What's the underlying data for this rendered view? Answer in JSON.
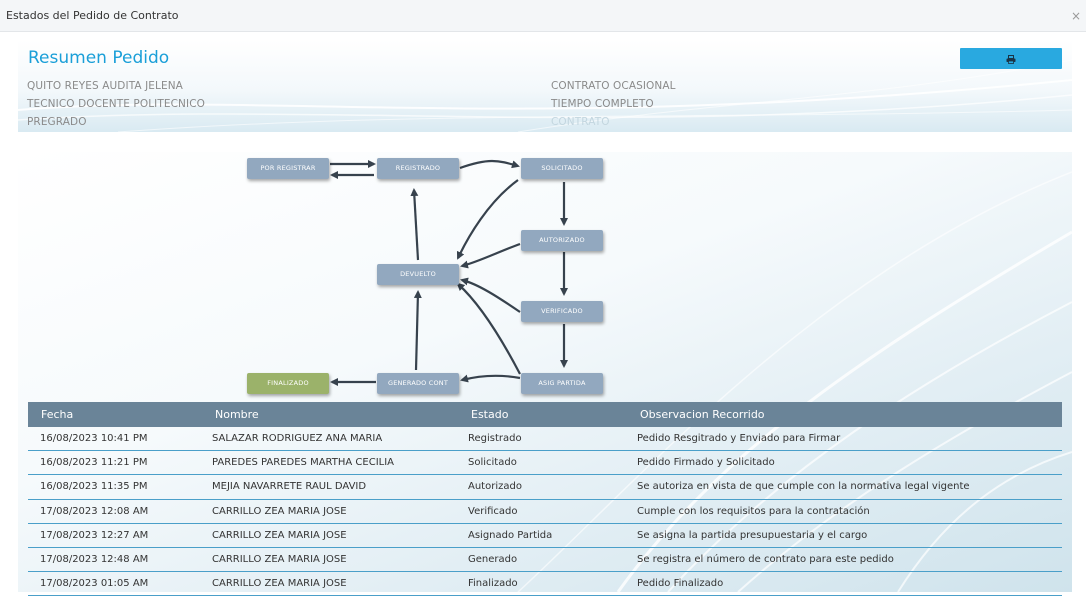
{
  "window": {
    "title": "Estados del Pedido de Contrato",
    "close": "×"
  },
  "summary": {
    "heading": "Resumen Pedido",
    "print_icon": "printer-icon",
    "left": [
      "QUITO REYES AUDITA JELENA",
      "TECNICO DOCENTE POLITECNICO",
      "PREGRADO"
    ],
    "right": [
      "CONTRATO OCASIONAL",
      "TIEMPO COMPLETO",
      "CONTRATO"
    ]
  },
  "flow": {
    "nodes": {
      "por_registrar": "POR REGISTRAR",
      "registrado": "REGISTRADO",
      "solicitado": "SOLICITADO",
      "autorizado": "AUTORIZADO",
      "devuelto": "DEVUELTO",
      "verificado": "VERIFICADO",
      "finalizado": "FINALIZADO",
      "generado_cont": "GENERADO CONT",
      "asig_partida": "ASIG PARTIDA"
    }
  },
  "table": {
    "headers": [
      "Fecha",
      "Nombre",
      "Estado",
      "Observacion Recorrido"
    ],
    "rows": [
      [
        "16/08/2023 10:41 PM",
        "SALAZAR RODRIGUEZ ANA MARIA",
        "Registrado",
        "Pedido Resgitrado y Enviado para Firmar"
      ],
      [
        "16/08/2023 11:21 PM",
        "PAREDES PAREDES MARTHA CECILIA",
        "Solicitado",
        "Pedido Firmado y Solicitado"
      ],
      [
        "16/08/2023 11:35 PM",
        "MEJIA NAVARRETE RAUL DAVID",
        "Autorizado",
        "Se autoriza en vista de que cumple con la normativa legal vigente"
      ],
      [
        "17/08/2023 12:08 AM",
        "CARRILLO ZEA MARIA JOSE",
        "Verificado",
        "Cumple con los requisitos para la contratación"
      ],
      [
        "17/08/2023 12:27 AM",
        "CARRILLO ZEA MARIA JOSE",
        "Asignado Partida",
        "Se asigna la partida presupuestaria y el cargo"
      ],
      [
        "17/08/2023 12:48 AM",
        "CARRILLO ZEA MARIA JOSE",
        "Generado",
        "Se registra el número de contrato para este pedido"
      ],
      [
        "17/08/2023 01:05 AM",
        "CARRILLO ZEA MARIA JOSE",
        "Finalizado",
        "Pedido Finalizado"
      ]
    ]
  },
  "colors": {
    "accent": "#29a9e0",
    "heading": "#1a9fd8",
    "table_header": "#6a8498",
    "node": "#92a8bf",
    "node_final": "#9bb26a"
  }
}
